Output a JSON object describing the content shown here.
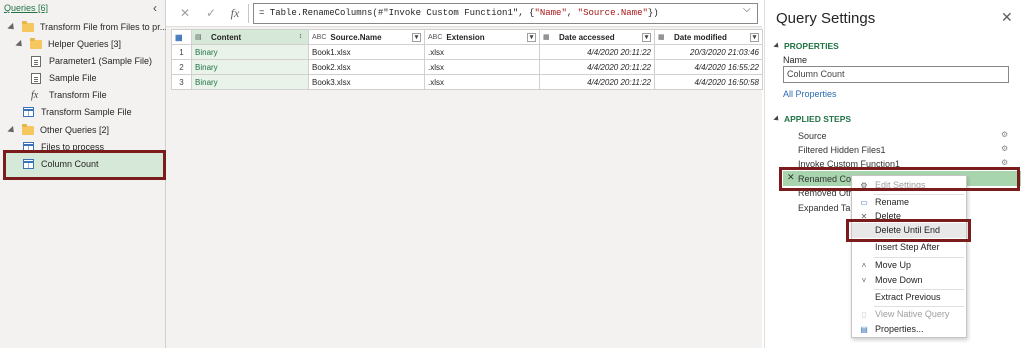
{
  "queries_pane": {
    "header": "Queries [6]",
    "collapse_glyph": "‹",
    "items": [
      {
        "label": "Transform File from Files to pr...",
        "kind": "folder"
      },
      {
        "label": "Helper Queries [3]",
        "kind": "folder"
      },
      {
        "label": "Parameter1 (Sample File)",
        "kind": "parameter"
      },
      {
        "label": "Sample File",
        "kind": "parameter"
      },
      {
        "label": "Transform File",
        "kind": "function"
      },
      {
        "label": "Transform Sample File",
        "kind": "table"
      },
      {
        "label": "Other Queries [2]",
        "kind": "folder"
      },
      {
        "label": "Files to process",
        "kind": "table"
      },
      {
        "label": "Column Count",
        "kind": "table"
      }
    ],
    "fx_glyph": "fx"
  },
  "formula_bar": {
    "cancel_glyph": "✕",
    "commit_glyph": "✓",
    "fx_glyph": "fx",
    "prefix": "= Table.RenameColumns(#\"Invoke Custom Function1\", {",
    "str1": "\"Name\"",
    "sep": ", ",
    "str2": "\"Source.Name\"",
    "suffix": "})",
    "expand_glyph": "⌵"
  },
  "grid": {
    "columns": [
      {
        "name": "Content",
        "type_icon": "▤"
      },
      {
        "name": "Source.Name",
        "type_icon": "ABC"
      },
      {
        "name": "Extension",
        "type_icon": "ABC"
      },
      {
        "name": "Date accessed",
        "type_icon": "▦"
      },
      {
        "name": "Date modified",
        "type_icon": "▦"
      }
    ],
    "content_sort_icon": "↕",
    "rows": [
      {
        "num": "1",
        "content": "Binary",
        "source": "Book1.xlsx",
        "ext": ".xlsx",
        "accessed": "4/4/2020 20:11:22",
        "modified": "20/3/2020 21:03:46"
      },
      {
        "num": "2",
        "content": "Binary",
        "source": "Book2.xlsx",
        "ext": ".xlsx",
        "accessed": "4/4/2020 20:11:22",
        "modified": "4/4/2020 16:55:22"
      },
      {
        "num": "3",
        "content": "Binary",
        "source": "Book3.xlsx",
        "ext": ".xlsx",
        "accessed": "4/4/2020 20:11:22",
        "modified": "4/4/2020 16:50:58"
      }
    ]
  },
  "settings": {
    "title": "Query Settings",
    "close_glyph": "✕",
    "properties_heading": "PROPERTIES",
    "name_label": "Name",
    "name_value": "Column Count",
    "all_properties": "All Properties",
    "steps_heading": "APPLIED STEPS",
    "steps": [
      {
        "label": "Source",
        "gear": true
      },
      {
        "label": "Filtered Hidden Files1",
        "gear": true
      },
      {
        "label": "Invoke Custom Function1",
        "gear": true
      },
      {
        "label": "Renamed Colu",
        "gear": false
      },
      {
        "label": "Removed Othe",
        "gear": false
      },
      {
        "label": "Expanded Tabl",
        "gear": false
      }
    ],
    "selected_step_x": "✕"
  },
  "context_menu": {
    "items": [
      {
        "label": "Edit Settings",
        "icon": "⚙",
        "disabled": true
      },
      {
        "label": "Rename",
        "icon": "▭",
        "disabled": false
      },
      {
        "label": "Delete",
        "icon": "✕",
        "disabled": false
      },
      {
        "label": "Delete Until End",
        "icon": "",
        "disabled": false
      },
      {
        "label": "Insert Step After",
        "icon": "",
        "disabled": false
      },
      {
        "label": "Move Up",
        "icon": "˄",
        "disabled": false
      },
      {
        "label": "Move Down",
        "icon": "˅",
        "disabled": false
      },
      {
        "label": "Extract Previous",
        "icon": "",
        "disabled": false
      },
      {
        "label": "View Native Query",
        "icon": "▯",
        "disabled": true
      },
      {
        "label": "Properties...",
        "icon": "▤",
        "disabled": false
      }
    ]
  },
  "colors": {
    "accent_green": "#217346",
    "selection_green": "#d6e9d8",
    "annotation_red": "#7b1c1c"
  }
}
